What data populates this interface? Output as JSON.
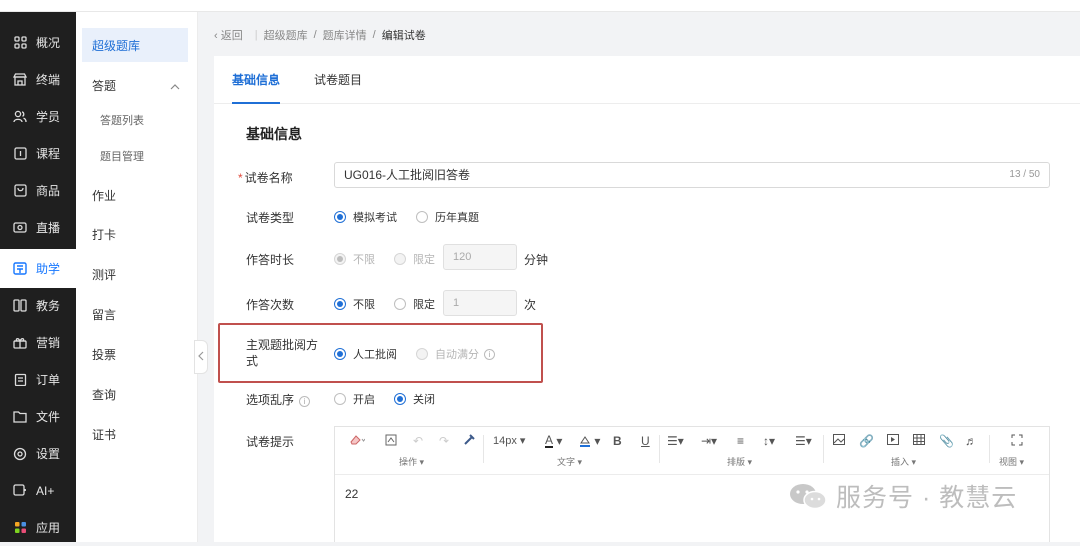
{
  "rail": [
    {
      "label": "概况",
      "icon": "grid-icon"
    },
    {
      "label": "终端",
      "icon": "store-icon"
    },
    {
      "label": "学员",
      "icon": "users-icon"
    },
    {
      "label": "课程",
      "icon": "course-icon"
    },
    {
      "label": "商品",
      "icon": "bag-icon"
    },
    {
      "label": "直播",
      "icon": "live-icon"
    },
    {
      "label": "助学",
      "icon": "study-icon",
      "active": true
    },
    {
      "label": "教务",
      "icon": "book-icon"
    },
    {
      "label": "营销",
      "icon": "gift-icon"
    },
    {
      "label": "订单",
      "icon": "order-icon"
    },
    {
      "label": "文件",
      "icon": "folder-icon"
    },
    {
      "label": "设置",
      "icon": "gear-icon"
    },
    {
      "label": "AI+",
      "icon": "ai-icon"
    },
    {
      "label": "应用",
      "icon": "apps-icon"
    }
  ],
  "submenu": {
    "items": [
      "超级题库",
      "答题",
      "答题列表",
      "题目管理",
      "作业",
      "打卡",
      "测评",
      "留言",
      "投票",
      "查询",
      "证书"
    ]
  },
  "breadcrumb": {
    "back": "返回",
    "sep": "|",
    "c1": "超级题库",
    "slash": "/",
    "c2": "题库详情",
    "c3": "编辑试卷"
  },
  "tabs": {
    "basic": "基础信息",
    "questions": "试卷题目"
  },
  "form": {
    "section_title": "基础信息",
    "name_label": "试卷名称",
    "name_value": "UG016-人工批阅旧答卷",
    "name_counter": "13 / 50",
    "type_label": "试卷类型",
    "type_opt1": "模拟考试",
    "type_opt2": "历年真题",
    "duration_label": "作答时长",
    "duration_opt1": "不限",
    "duration_opt2": "限定",
    "duration_value": "120",
    "duration_unit": "分钟",
    "times_label": "作答次数",
    "times_opt1": "不限",
    "times_opt2": "限定",
    "times_value": "1",
    "times_unit": "次",
    "review_label_line1": "主观题批阅方",
    "review_label_line2": "式",
    "review_opt1": "人工批阅",
    "review_opt2": "自动满分",
    "shuffle_label": "选项乱序",
    "shuffle_opt1": "开启",
    "shuffle_opt2": "关闭",
    "tip_label": "试卷提示"
  },
  "editor": {
    "font_size": "14px",
    "groups": {
      "ops": "操作",
      "text": "文字",
      "layout": "排版",
      "insert": "插入",
      "view": "视图"
    },
    "bold": "B",
    "underline": "U",
    "content": "22"
  },
  "watermark": "服务号 · 教慧云",
  "colors": {
    "accent": "#1f6fd6",
    "rail": "#1f1f1f",
    "highlight": "#c0504d"
  }
}
